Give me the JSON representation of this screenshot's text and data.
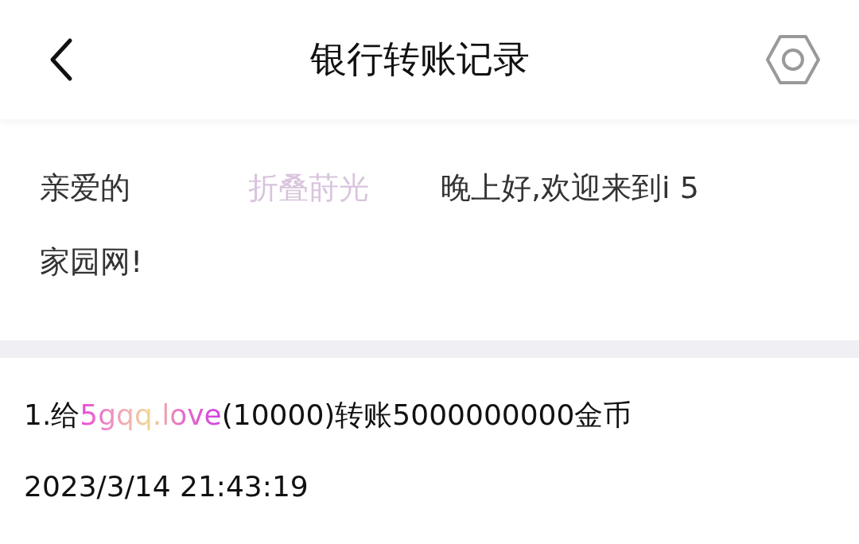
{
  "header": {
    "title": "银行转账记录"
  },
  "greeting": {
    "prefix": "亲爱的",
    "username": "折叠莳光",
    "message": "晚上好,欢迎来到i 5",
    "message_continued": "家园网!"
  },
  "records": [
    {
      "text_before": "1.给",
      "recipient": "5gqq.love",
      "text_after": "(10000)转账5000000000金币",
      "time": "2023/3/14 21:43:19"
    }
  ]
}
